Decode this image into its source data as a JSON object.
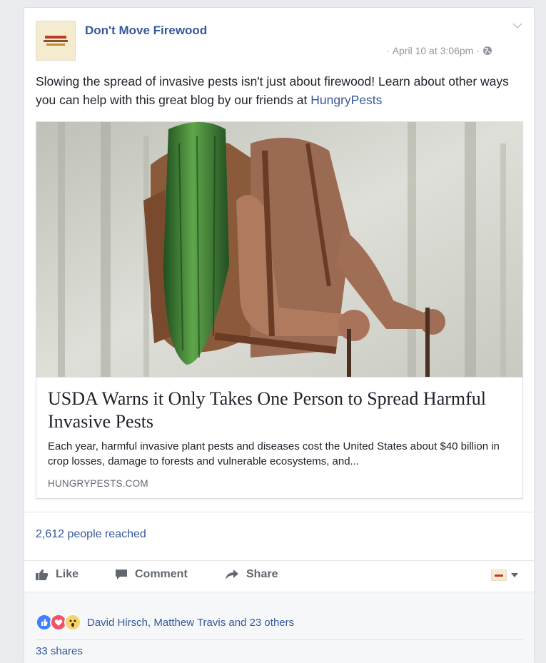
{
  "post": {
    "page_name": "Don't Move Firewood",
    "timestamp": "April 10 at 3:06pm",
    "meta_separator": "·",
    "text_main": "Slowing the spread of invasive pests isn't just about firewood! Learn about other ways you can help with this great blog by our friends at ",
    "text_link": "HungryPests"
  },
  "link_preview": {
    "title": "USDA Warns it Only Takes One Person to Spread Harmful Invasive Pests",
    "description": "Each year, harmful invasive plant pests and diseases cost the United States about $40 billion in crop losses, damage to forests and vulnerable ecosystems, and...",
    "domain": "HUNGRYPESTS.COM"
  },
  "stats": {
    "reach": "2,612 people reached",
    "reactors": "David Hirsch, Matthew Travis and 23 others",
    "shares": "33 shares"
  },
  "actions": {
    "like": "Like",
    "comment": "Comment",
    "share": "Share"
  },
  "icons": {
    "globe": "globe-icon",
    "chevron": "chevron-down-icon",
    "like": "thumbs-up-icon",
    "comment": "comment-icon",
    "share": "share-arrow-icon"
  },
  "colors": {
    "link": "#365899",
    "muted": "#90949c",
    "action": "#606770",
    "like_reaction": "#4080ff",
    "love_reaction": "#f25268",
    "wow_reaction": "#f7d36b"
  }
}
